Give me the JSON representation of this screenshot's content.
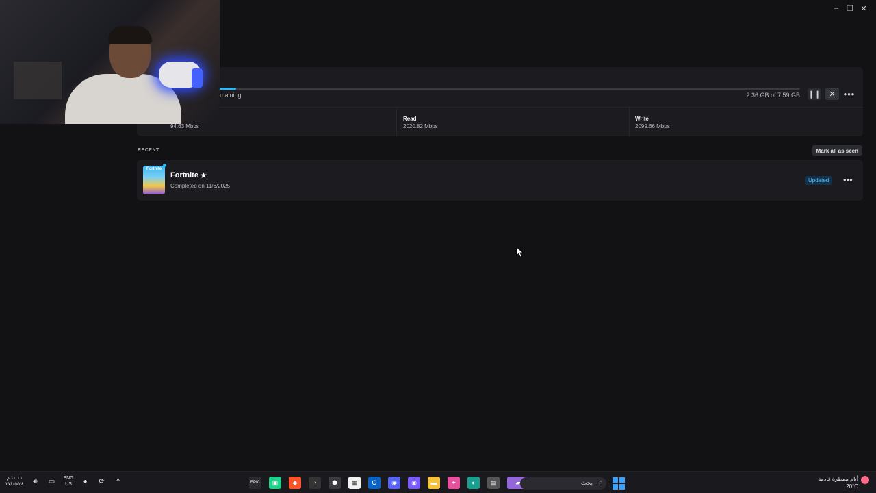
{
  "window": {
    "minimize": "–",
    "maximize": "❐",
    "close": "✕"
  },
  "download": {
    "remaining_text": "maining",
    "size_text": "2.36 GB of 7.59 GB",
    "progress": 0.03,
    "pause_icon": "❙❙",
    "cancel_icon": "✕",
    "more_icon": "•••"
  },
  "stats": {
    "network": {
      "value": "94.63 Mbps"
    },
    "read": {
      "label": "Read",
      "value": "2020.82 Mbps"
    },
    "write": {
      "label": "Write",
      "value": "2099.66 Mbps"
    }
  },
  "recent": {
    "label": "RECENT",
    "mark_all_label": "Mark all as seen",
    "items": [
      {
        "title": "Fortnite",
        "thumb_title": "Fortnite",
        "star": "★",
        "completed": "Completed on 11/6/2025",
        "badge": "Updated",
        "more": "•••"
      }
    ]
  },
  "taskbar": {
    "clock_time": "١٠:٠١ م",
    "clock_date": "٢٧/٠٥/٢٨",
    "lang_top": "ENG",
    "lang_bottom": "US",
    "search_text": "بحث",
    "search_icon": "⌕",
    "weather_text": "أيام ممطرة قادمة",
    "weather_temp": "20°C"
  },
  "colors": {
    "accent": "#26bbff",
    "badge_bg": "#12314a",
    "badge_text": "#5ec5ff"
  }
}
